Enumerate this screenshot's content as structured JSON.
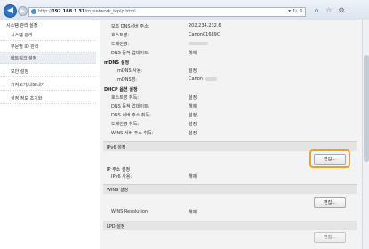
{
  "browser": {
    "url_prefix": "http://",
    "url_host": "192.168.1.31",
    "url_path": "/m_network_tcpip.html",
    "address_controls": "▾ ↻ ✕",
    "tab_icons": [
      "⌂",
      "☆",
      "⚙"
    ]
  },
  "sidebar": {
    "header": "시스템 관리 설정",
    "items": [
      {
        "label": "시스템 관리"
      },
      {
        "label": "부문별 ID 관리"
      },
      {
        "label": "네트워크 설정"
      },
      {
        "label": "보안 설정"
      },
      {
        "label": "가져오기/내보내기"
      },
      {
        "label": "설정 정보 초기화"
      }
    ]
  },
  "dns": {
    "secondary_label": "보조 DNS서버 주소:",
    "secondary_value": "202.234.232.6",
    "host_label": "호스트명:",
    "host_value": "Canon01689C",
    "domain_label": "도메인명:",
    "dynamic_label": "DNS 동적 업데이트:",
    "dynamic_value": "해제"
  },
  "mdns": {
    "title": "mDNS 설정",
    "use_label": "mDNS 사용:",
    "use_value": "설정",
    "name_label": "mDNS명:",
    "name_value": "Canon"
  },
  "dhcp": {
    "title": "DHCP 옵션 설정",
    "rows": [
      {
        "label": "호스트명 취득:",
        "value": "설정"
      },
      {
        "label": "DNS 동적 업데이트:",
        "value": "해제"
      },
      {
        "label": "DNS 서버 주소 취득:",
        "value": "설정"
      },
      {
        "label": "도메인명 취득:",
        "value": "설정"
      },
      {
        "label": "WINS 서버 주소 취득:",
        "value": "설정"
      }
    ]
  },
  "ipv6": {
    "title": "IPv6 설정",
    "edit_label": "편집...",
    "sub_title": "IP 주소 설정",
    "use_label": "IPv6 사용:",
    "use_value": "해제"
  },
  "wins": {
    "title": "WINS 설정",
    "edit_label": "편집...",
    "resolution_label": "WINS Resolution:",
    "resolution_value": "해제"
  },
  "lpd": {
    "title": "LPD 설정",
    "edit_label": "편집..."
  },
  "colors": {
    "highlight": "#f29f1f",
    "back_button": "#2e75c9"
  }
}
